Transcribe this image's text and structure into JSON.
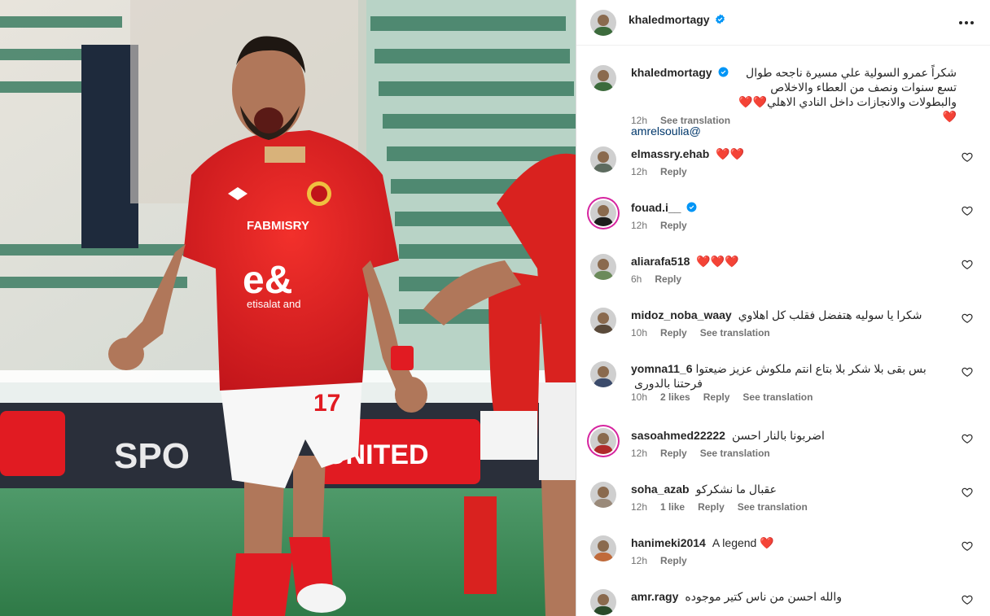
{
  "post": {
    "author": "khaledmortagy",
    "caption": "شكراً عمرو السولية علي مسيرة ناجحه طوال تسع سنوات ونصف من العطاء والاخلاص والبطولات والانجازات داخل النادي الاهلي❤️❤️❤️",
    "mention": "amrelsoulia@",
    "caption_time": "12h",
    "caption_translate": "See translation"
  },
  "media": {
    "shirt_sponsor_top": "FABMISRY",
    "shirt_sponsor_main": "etisalat and",
    "shirt_number": "17",
    "board_text_left": "SPO",
    "board_text_right": "UNITED",
    "accent_red": "#e11b22",
    "pitch_green": "#3f8f5a"
  },
  "actions": {
    "reply": "Reply",
    "see_translation": "See translation"
  },
  "comments": [
    {
      "user": "elmassry.ehab",
      "text": "❤️❤️",
      "time": "12h",
      "likes": "",
      "translate": false,
      "verified": false,
      "ring": false
    },
    {
      "user": "fouad.i__",
      "text": "",
      "time": "12h",
      "likes": "",
      "translate": false,
      "verified": true,
      "ring": true
    },
    {
      "user": "aliarafa518",
      "text": "❤️❤️❤️",
      "time": "6h",
      "likes": "",
      "translate": false,
      "verified": false,
      "ring": false
    },
    {
      "user": "midoz_noba_waay",
      "text": "شكرا يا سوليه هتفضل فقلب كل اهلاوي",
      "time": "10h",
      "likes": "",
      "translate": true,
      "verified": false,
      "ring": false
    },
    {
      "user": "yomna11_6",
      "text": "بس بقى بلا شكر بلا بتاع انتم ملكوش عزيز ضيعتوا فرحتنا بالدورى",
      "time": "10h",
      "likes": "2 likes",
      "translate": true,
      "verified": false,
      "ring": false
    },
    {
      "user": "sasoahmed22222",
      "text": "اضربونا بالنار احسن",
      "time": "12h",
      "likes": "",
      "translate": true,
      "verified": false,
      "ring": true
    },
    {
      "user": "soha_azab",
      "text": "عقبال ما نشكركو",
      "time": "12h",
      "likes": "1 like",
      "translate": true,
      "verified": false,
      "ring": false
    },
    {
      "user": "hanimeki2014",
      "text": "A legend ❤️",
      "time": "12h",
      "likes": "",
      "translate": false,
      "verified": false,
      "ring": false
    },
    {
      "user": "amr.ragy",
      "text": "والله احسن من ناس كتير موجوده",
      "time": "",
      "likes": "",
      "translate": false,
      "verified": false,
      "ring": false
    }
  ],
  "icons": {
    "verified": "verified-badge-icon",
    "heart": "heart-outline-icon",
    "more": "more-horizontal-icon"
  },
  "colors": {
    "verified_blue": "#0095f6",
    "link": "#00376b",
    "meta_gray": "#737373"
  }
}
